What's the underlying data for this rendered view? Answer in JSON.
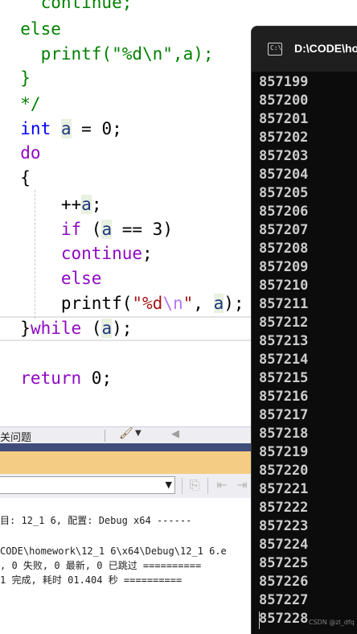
{
  "editor": {
    "lines": [
      {
        "tokens": [
          {
            "t": "    continue;",
            "c": "tok-comment"
          }
        ]
      },
      {
        "tokens": [
          {
            "t": "  else",
            "c": "tok-comment"
          }
        ]
      },
      {
        "tokens": [
          {
            "t": "    printf(\"%d\\n\",a);",
            "c": "tok-comment"
          }
        ]
      },
      {
        "tokens": [
          {
            "t": "  }",
            "c": "tok-comment"
          }
        ]
      },
      {
        "tokens": [
          {
            "t": "  */",
            "c": "tok-comment"
          }
        ]
      },
      {
        "tokens": [
          {
            "t": "  int",
            "c": "tok-kw"
          },
          {
            "t": " ",
            "c": "tok-plain"
          },
          {
            "t": "a",
            "c": "tok-var"
          },
          {
            "t": " = 0;",
            "c": "tok-plain"
          }
        ]
      },
      {
        "tokens": [
          {
            "t": "  do",
            "c": "tok-kwc"
          }
        ]
      },
      {
        "tokens": [
          {
            "t": "  {",
            "c": "tok-plain"
          }
        ]
      },
      {
        "tokens": [
          {
            "t": "      ++",
            "c": "tok-plain"
          },
          {
            "t": "a",
            "c": "tok-var"
          },
          {
            "t": ";",
            "c": "tok-plain"
          }
        ]
      },
      {
        "tokens": [
          {
            "t": "      if",
            "c": "tok-kwc"
          },
          {
            "t": " (",
            "c": "tok-plain"
          },
          {
            "t": "a",
            "c": "tok-var"
          },
          {
            "t": " == 3)",
            "c": "tok-plain"
          }
        ]
      },
      {
        "tokens": [
          {
            "t": "      continue",
            "c": "tok-kwc"
          },
          {
            "t": ";",
            "c": "tok-plain"
          }
        ]
      },
      {
        "tokens": [
          {
            "t": "      else",
            "c": "tok-kwc"
          }
        ]
      },
      {
        "tokens": [
          {
            "t": "      printf(",
            "c": "tok-plain"
          },
          {
            "t": "\"%d",
            "c": "tok-str"
          },
          {
            "t": "\\n",
            "c": "tok-esc"
          },
          {
            "t": "\"",
            "c": "tok-str"
          },
          {
            "t": ", ",
            "c": "tok-plain"
          },
          {
            "t": "a",
            "c": "tok-var"
          },
          {
            "t": ");",
            "c": "tok-plain"
          }
        ]
      },
      {
        "tokens": [
          {
            "t": "  }",
            "c": "tok-plain"
          },
          {
            "t": "while",
            "c": "tok-kwc"
          },
          {
            "t": " (",
            "c": "tok-plain"
          },
          {
            "t": "a",
            "c": "tok-var"
          },
          {
            "t": ");",
            "c": "tok-plain"
          }
        ]
      },
      {
        "tokens": []
      },
      {
        "tokens": [
          {
            "t": "  return",
            "c": "tok-kwc"
          },
          {
            "t": " 0;",
            "c": "tok-plain"
          }
        ]
      }
    ]
  },
  "panel_tabs": {
    "tab_label": "关问题",
    "brush_icon": "paintbrush-icon",
    "caret_icon": "caret-down-icon",
    "arrow_icon": "arrow-left-icon"
  },
  "output": {
    "lines": [
      "目: 12_1 6, 配置: Debug x64 ------",
      "CODE\\homework\\12_1 6\\x64\\Debug\\12_1 6.e",
      ", 0 失败, 0 最新, 0 已跳过 ==========",
      "1 完成, 耗时 01.404 秒 =========="
    ]
  },
  "console": {
    "title": "D:\\CODE\\ho",
    "icon": "console-app-icon",
    "lines": [
      "857199",
      "857200",
      "857201",
      "857202",
      "857203",
      "857204",
      "857205",
      "857206",
      "857207",
      "857208",
      "857209",
      "857210",
      "857211",
      "857212",
      "857213",
      "857214",
      "857215",
      "857216",
      "857217",
      "857218",
      "857219",
      "857220",
      "857221",
      "857222",
      "857223",
      "857224",
      "857225",
      "857226",
      "857227",
      "857228"
    ]
  },
  "watermark": "CSDN @zl_dfq",
  "colors": {
    "editor_bg": "#ffffff",
    "console_bg": "#0c0c0c",
    "console_titlebar": "#1f1f1f",
    "output_title_bg": "#f5cc84",
    "output_header_bg": "#3f4d7a"
  }
}
